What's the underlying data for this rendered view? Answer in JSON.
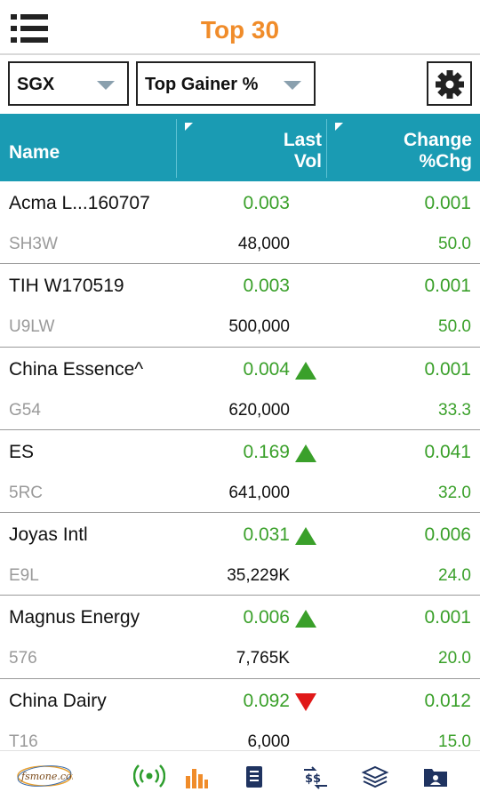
{
  "header": {
    "title": "Top 30"
  },
  "filters": {
    "exchange": "SGX",
    "category": "Top Gainer %"
  },
  "table": {
    "col_name": "Name",
    "col_last": "Last",
    "col_vol": "Vol",
    "col_change": "Change",
    "col_pct": "%Chg",
    "rows": [
      {
        "name": "Acma L...160707",
        "code": "SH3W",
        "last": "0.003",
        "vol": "48,000",
        "change": "0.001",
        "pct": "50.0",
        "trend": "none"
      },
      {
        "name": "TIH W170519",
        "code": "U9LW",
        "last": "0.003",
        "vol": "500,000",
        "change": "0.001",
        "pct": "50.0",
        "trend": "none"
      },
      {
        "name": "China Essence^",
        "code": "G54",
        "last": "0.004",
        "vol": "620,000",
        "change": "0.001",
        "pct": "33.3",
        "trend": "up"
      },
      {
        "name": "ES",
        "code": "5RC",
        "last": "0.169",
        "vol": "641,000",
        "change": "0.041",
        "pct": "32.0",
        "trend": "up"
      },
      {
        "name": "Joyas Intl",
        "code": "E9L",
        "last": "0.031",
        "vol": "35,229K",
        "change": "0.006",
        "pct": "24.0",
        "trend": "up"
      },
      {
        "name": "Magnus Energy",
        "code": "576",
        "last": "0.006",
        "vol": "7,765K",
        "change": "0.001",
        "pct": "20.0",
        "trend": "up"
      },
      {
        "name": "China Dairy",
        "code": "T16",
        "last": "0.092",
        "vol": "6,000",
        "change": "0.012",
        "pct": "15.0",
        "trend": "down"
      }
    ]
  },
  "colors": {
    "accent": "#f08c2a",
    "header_bg": "#1a9bb3",
    "gain": "#3aa02a",
    "loss": "#e01818"
  },
  "bottom_nav": {
    "logo_text": "fsmone.com.sg",
    "icons": [
      "live-signal-icon",
      "bar-chart-icon",
      "document-icon",
      "currency-exchange-icon",
      "layers-icon",
      "portfolio-folder-icon"
    ]
  }
}
